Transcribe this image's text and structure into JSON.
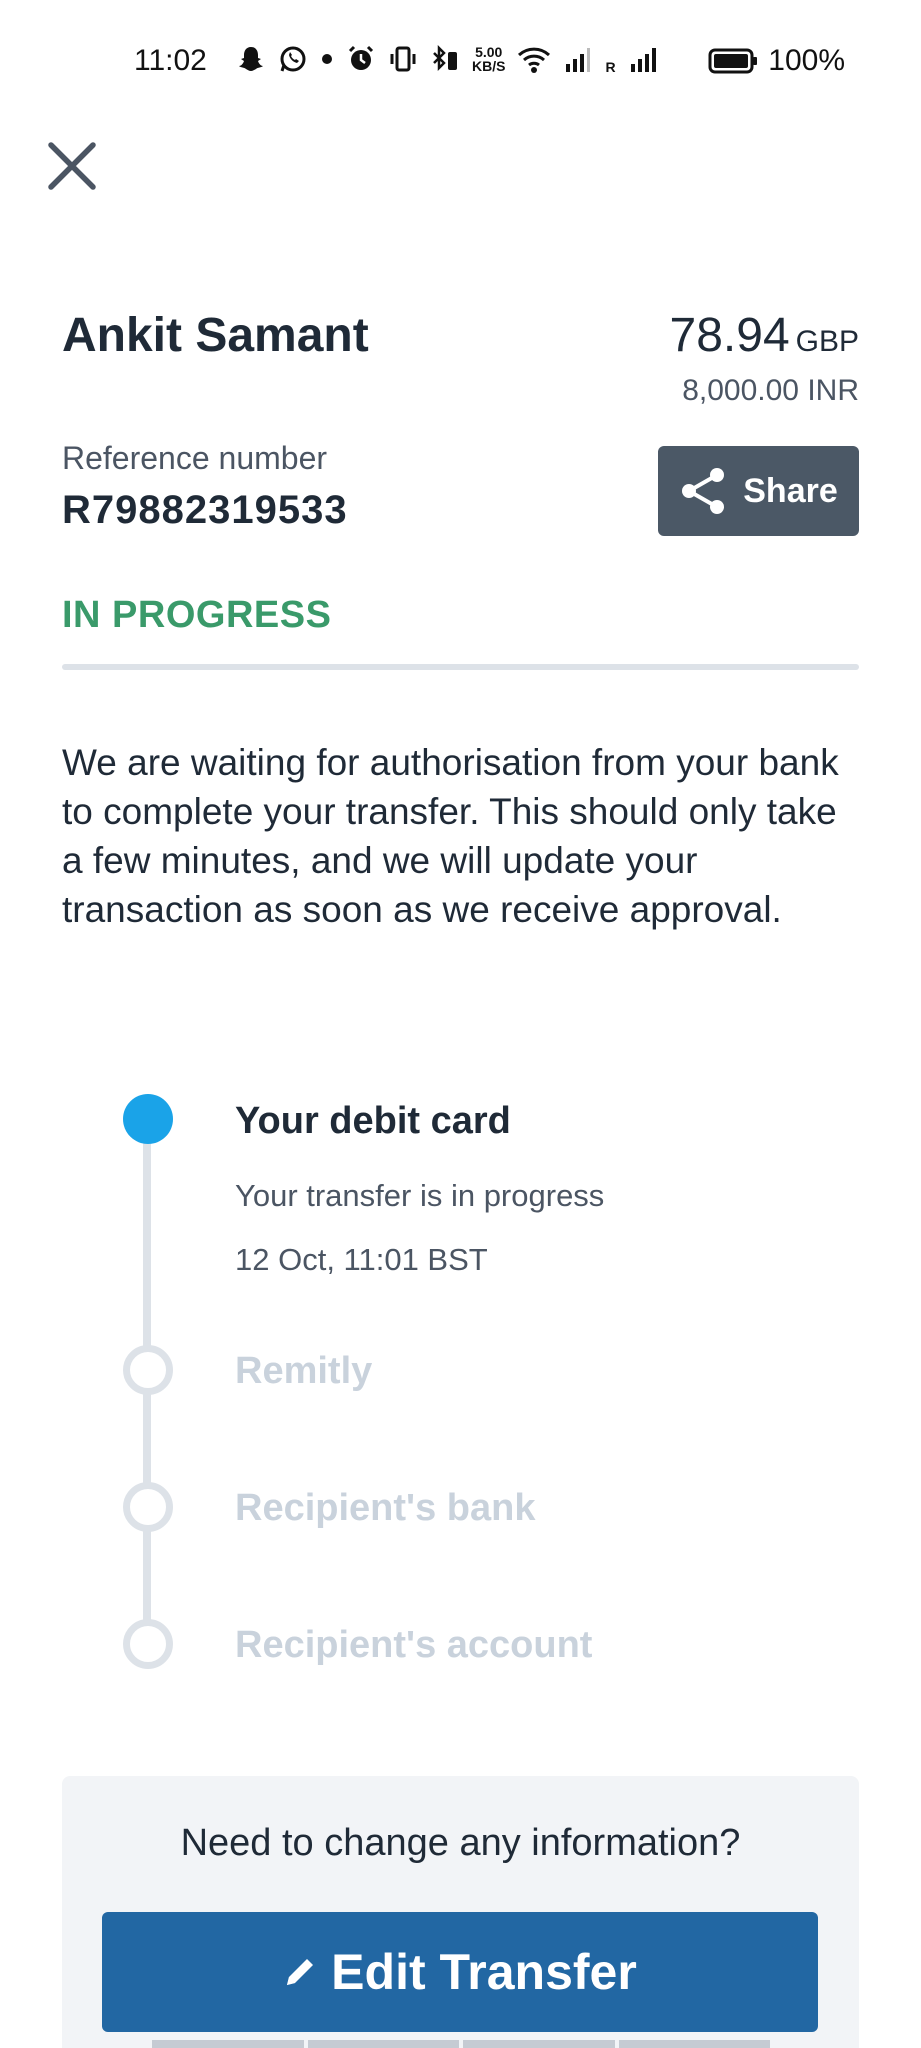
{
  "status_bar": {
    "time": "11:02",
    "net_speed_top": "5.00",
    "net_speed_bottom": "KB/S",
    "roaming": "R",
    "battery": "100%"
  },
  "header": {
    "recipient_name": "Ankit Samant",
    "amount": "78.94",
    "amount_currency": "GBP",
    "received_amount": "8,000.00 INR",
    "reference_label": "Reference number",
    "reference_number": "R79882319533",
    "share_label": "Share"
  },
  "status": {
    "label": "IN PROGRESS",
    "description": "We are waiting for authorisation from your bank to complete your transfer. This should only take a few minutes, and we will update your transaction as soon as we receive approval."
  },
  "timeline": {
    "active": {
      "title": "Your debit card",
      "subtitle": "Your transfer is in progress",
      "time": "12 Oct, 11:01 BST"
    },
    "steps": [
      "Remitly",
      "Recipient's bank",
      "Recipient's account"
    ]
  },
  "change_panel": {
    "question": "Need to change any information?",
    "edit_label": "Edit Transfer"
  },
  "colors": {
    "status_green": "#3a9a6a",
    "active_dot": "#1aa3e8",
    "edit_button": "#2267a3",
    "share_button": "#4b5866"
  }
}
